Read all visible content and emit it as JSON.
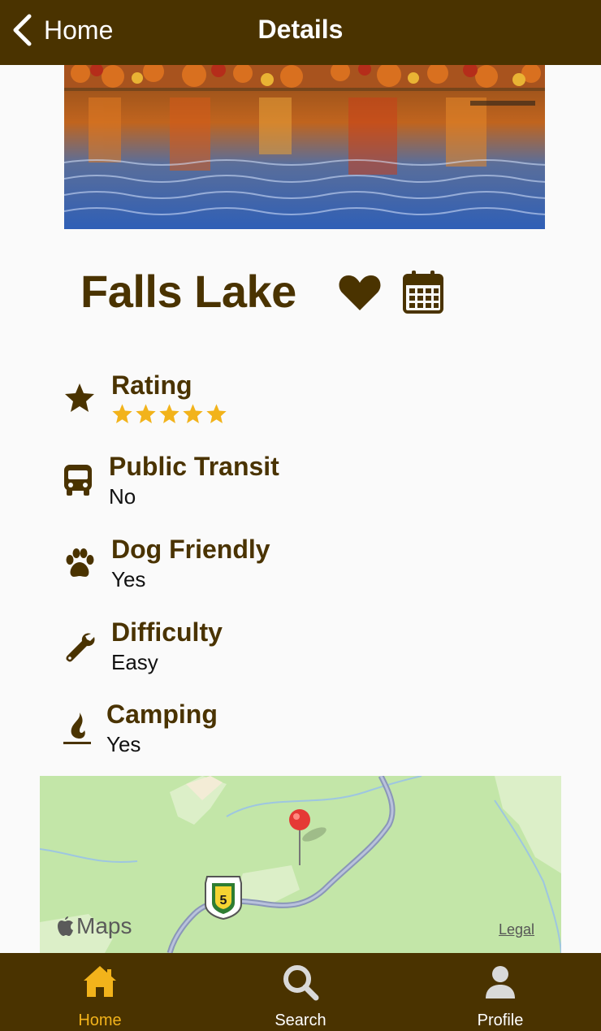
{
  "navbar": {
    "back_label": "Home",
    "title": "Details"
  },
  "park": {
    "name": "Falls Lake"
  },
  "details": {
    "rating": {
      "label": "Rating",
      "stars": 5,
      "max_stars": 5
    },
    "transit": {
      "label": "Public Transit",
      "value": "No"
    },
    "dog": {
      "label": "Dog Friendly",
      "value": "Yes"
    },
    "difficulty": {
      "label": "Difficulty",
      "value": "Easy"
    },
    "camping": {
      "label": "Camping",
      "value": "Yes"
    }
  },
  "map": {
    "brand": "Maps",
    "legal": "Legal",
    "route_shield": "5"
  },
  "tabbar": {
    "tabs": [
      {
        "label": "Home",
        "icon": "home-icon",
        "active": true
      },
      {
        "label": "Search",
        "icon": "search-icon",
        "active": false
      },
      {
        "label": "Profile",
        "icon": "person-icon",
        "active": false
      }
    ]
  },
  "colors": {
    "brand_brown": "#4a3300",
    "star_gold": "#f2b31b",
    "map_green": "#c3e6a8",
    "pin_red": "#e53935"
  }
}
